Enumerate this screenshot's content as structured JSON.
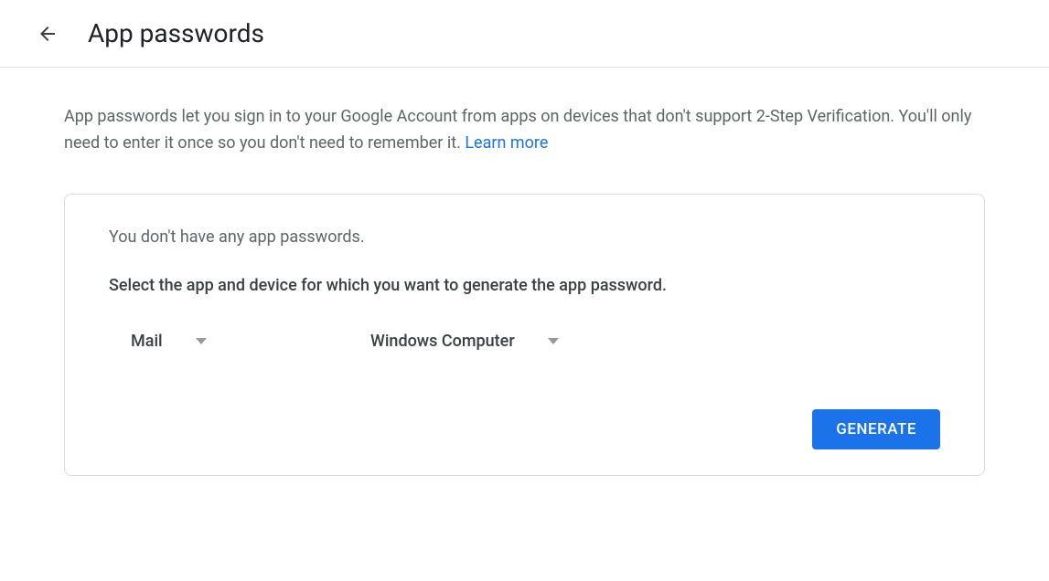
{
  "header": {
    "title": "App passwords"
  },
  "main": {
    "description": "App passwords let you sign in to your Google Account from apps on devices that don't support 2-Step Verification. You'll only need to enter it once so you don't need to remember it. ",
    "learn_more": "Learn more"
  },
  "card": {
    "status": "You don't have any app passwords.",
    "instruction": "Select the app and device for which you want to generate the app password.",
    "app_select": {
      "selected": "Mail"
    },
    "device_select": {
      "selected": "Windows Computer"
    },
    "generate_label": "GENERATE"
  }
}
